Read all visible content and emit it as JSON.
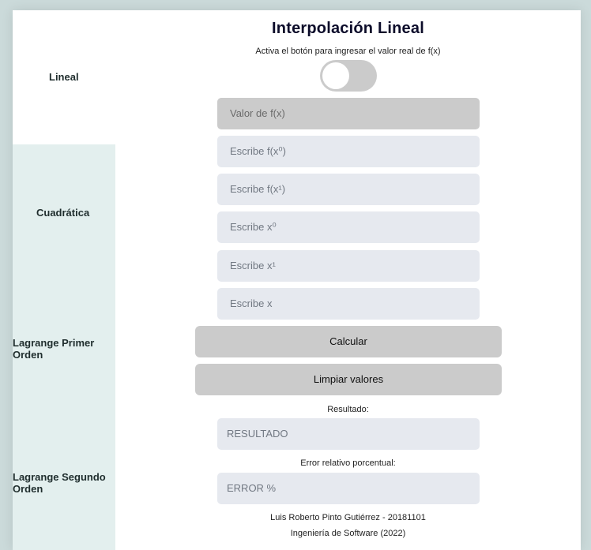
{
  "sidebar": {
    "items": [
      {
        "label": "Lineal"
      },
      {
        "label": "Cuadrática"
      },
      {
        "label": "Lagrange Primer Orden"
      },
      {
        "label": "Lagrange Segundo Orden"
      }
    ]
  },
  "main": {
    "title": "Interpolación Lineal",
    "toggle_hint": "Activa el botón para ingresar el valor real de f(x)",
    "toggle_on": false,
    "fields": {
      "real_fx_placeholder": "Valor de f(x)",
      "fx0_placeholder": "Escribe f(x⁰)",
      "fx1_placeholder": "Escribe f(x¹)",
      "x0_placeholder": "Escribe x⁰",
      "x1_placeholder": "Escribe x¹",
      "x_placeholder": "Escribe x"
    },
    "buttons": {
      "calculate": "Calcular",
      "clear": "Limpiar valores"
    },
    "result_label": "Resultado:",
    "result_value": "RESULTADO",
    "error_label": "Error relativo porcentual:",
    "error_value": "ERROR %"
  },
  "footer": {
    "author": "Luis Roberto Pinto Gutiérrez - 20181101",
    "program": "Ingeniería de Software (2022)"
  },
  "colors": {
    "background": "#cbdada",
    "sidebar_alt": "#e3efee",
    "input": "#e6e9ef",
    "disabled": "#cbcbcb"
  }
}
